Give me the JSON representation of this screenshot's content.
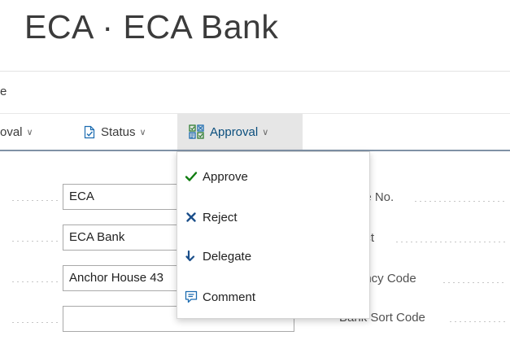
{
  "page": {
    "title": "ECA · ECA Bank"
  },
  "tabs": {
    "fragment": "e"
  },
  "actions": {
    "prev_label": "oval",
    "status_label": "Status",
    "approval_label": "Approval"
  },
  "menu": {
    "items": [
      {
        "label": "Approve",
        "icon": "checkmark-icon"
      },
      {
        "label": "Reject",
        "icon": "x-icon"
      },
      {
        "label": "Delegate",
        "icon": "delegate-arrow-icon"
      },
      {
        "label": "Comment",
        "icon": "comment-icon"
      }
    ]
  },
  "form": {
    "fields": [
      {
        "value": "ECA"
      },
      {
        "value": "ECA Bank"
      },
      {
        "value": "Anchor House 43"
      },
      {
        "value": ""
      }
    ],
    "right_labels": [
      "ne No.",
      "act",
      "ency Code",
      "Bank Sort Code"
    ]
  },
  "colors": {
    "accent": "#0a4e7d",
    "check": "#107c10",
    "reject": "#1b4f8a",
    "divider_blue": "#8092a6"
  }
}
